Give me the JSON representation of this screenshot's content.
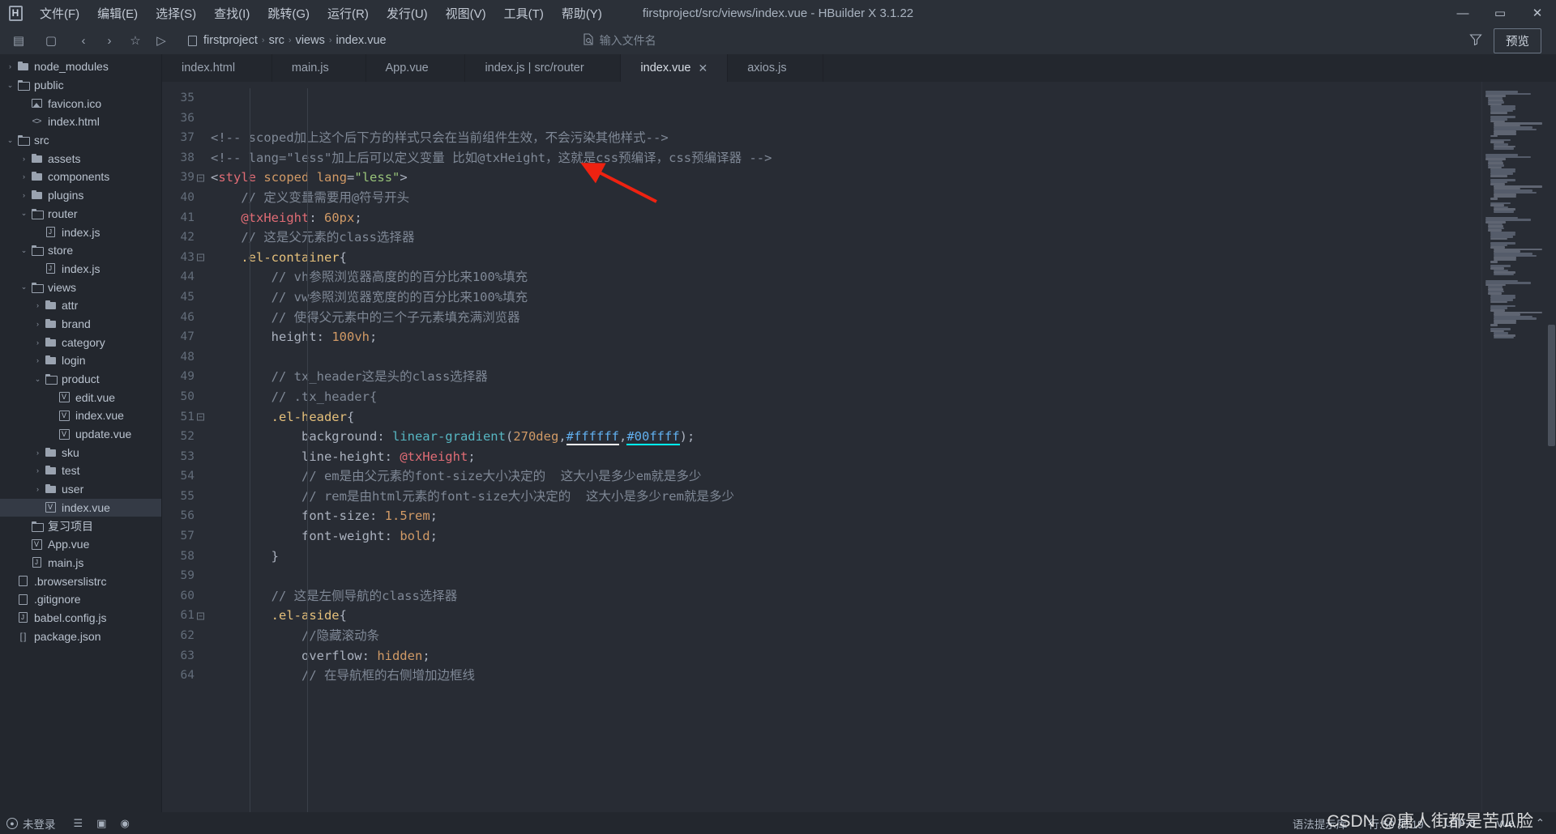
{
  "window": {
    "title": "firstproject/src/views/index.vue - HBuilder X 3.1.22",
    "logo": "H",
    "minimize": "—",
    "maximize": "▭",
    "close": "✕"
  },
  "menu": [
    {
      "label": "文件(F)",
      "name": "menu-file"
    },
    {
      "label": "编辑(E)",
      "name": "menu-edit"
    },
    {
      "label": "选择(S)",
      "name": "menu-select"
    },
    {
      "label": "查找(I)",
      "name": "menu-find"
    },
    {
      "label": "跳转(G)",
      "name": "menu-goto"
    },
    {
      "label": "运行(R)",
      "name": "menu-run"
    },
    {
      "label": "发行(U)",
      "name": "menu-publish"
    },
    {
      "label": "视图(V)",
      "name": "menu-view"
    },
    {
      "label": "工具(T)",
      "name": "menu-tools"
    },
    {
      "label": "帮助(Y)",
      "name": "menu-help"
    }
  ],
  "toolbar": {
    "buttons": [
      "▤",
      "▢",
      "‹",
      "›",
      "☆",
      "▷"
    ],
    "breadcrumb": [
      "firstproject",
      "src",
      "views",
      "index.vue"
    ],
    "breadcrumb_sep": "›",
    "file_search_placeholder": "输入文件名",
    "file_search_icon": "🔍",
    "filter_icon": "▽",
    "preview_label": "预览"
  },
  "sidebar": {
    "items": [
      {
        "label": "node_modules",
        "depth": 0,
        "arrow": "›",
        "icon": "folder",
        "selected": false
      },
      {
        "label": "public",
        "depth": 0,
        "arrow": "⌄",
        "icon": "folder-open",
        "selected": false
      },
      {
        "label": "favicon.ico",
        "depth": 1,
        "arrow": "",
        "icon": "image",
        "selected": false
      },
      {
        "label": "index.html",
        "depth": 1,
        "arrow": "",
        "icon": "code",
        "selected": false
      },
      {
        "label": "src",
        "depth": 0,
        "arrow": "⌄",
        "icon": "folder-open",
        "selected": false
      },
      {
        "label": "assets",
        "depth": 1,
        "arrow": "›",
        "icon": "folder",
        "selected": false
      },
      {
        "label": "components",
        "depth": 1,
        "arrow": "›",
        "icon": "folder",
        "selected": false
      },
      {
        "label": "plugins",
        "depth": 1,
        "arrow": "›",
        "icon": "folder",
        "selected": false
      },
      {
        "label": "router",
        "depth": 1,
        "arrow": "⌄",
        "icon": "folder-open",
        "selected": false
      },
      {
        "label": "index.js",
        "depth": 2,
        "arrow": "",
        "icon": "js",
        "selected": false
      },
      {
        "label": "store",
        "depth": 1,
        "arrow": "⌄",
        "icon": "folder-open",
        "selected": false
      },
      {
        "label": "index.js",
        "depth": 2,
        "arrow": "",
        "icon": "js",
        "selected": false
      },
      {
        "label": "views",
        "depth": 1,
        "arrow": "⌄",
        "icon": "folder-open",
        "selected": false
      },
      {
        "label": "attr",
        "depth": 2,
        "arrow": "›",
        "icon": "folder",
        "selected": false
      },
      {
        "label": "brand",
        "depth": 2,
        "arrow": "›",
        "icon": "folder",
        "selected": false
      },
      {
        "label": "category",
        "depth": 2,
        "arrow": "›",
        "icon": "folder",
        "selected": false
      },
      {
        "label": "login",
        "depth": 2,
        "arrow": "›",
        "icon": "folder",
        "selected": false
      },
      {
        "label": "product",
        "depth": 2,
        "arrow": "⌄",
        "icon": "folder-open",
        "selected": false
      },
      {
        "label": "edit.vue",
        "depth": 3,
        "arrow": "",
        "icon": "vue",
        "selected": false
      },
      {
        "label": "index.vue",
        "depth": 3,
        "arrow": "",
        "icon": "vue",
        "selected": false
      },
      {
        "label": "update.vue",
        "depth": 3,
        "arrow": "",
        "icon": "vue",
        "selected": false
      },
      {
        "label": "sku",
        "depth": 2,
        "arrow": "›",
        "icon": "folder",
        "selected": false
      },
      {
        "label": "test",
        "depth": 2,
        "arrow": "›",
        "icon": "folder",
        "selected": false
      },
      {
        "label": "user",
        "depth": 2,
        "arrow": "›",
        "icon": "folder",
        "selected": false
      },
      {
        "label": "index.vue",
        "depth": 2,
        "arrow": "",
        "icon": "vue",
        "selected": true
      },
      {
        "label": "复习项目",
        "depth": 1,
        "arrow": "",
        "icon": "folder-open",
        "selected": false
      },
      {
        "label": "App.vue",
        "depth": 1,
        "arrow": "",
        "icon": "vue",
        "selected": false
      },
      {
        "label": "main.js",
        "depth": 1,
        "arrow": "",
        "icon": "js",
        "selected": false
      },
      {
        "label": ".browserslistrc",
        "depth": 0,
        "arrow": "",
        "icon": "doc",
        "selected": false
      },
      {
        "label": ".gitignore",
        "depth": 0,
        "arrow": "",
        "icon": "doc",
        "selected": false
      },
      {
        "label": "babel.config.js",
        "depth": 0,
        "arrow": "",
        "icon": "js",
        "selected": false
      },
      {
        "label": "package.json",
        "depth": 0,
        "arrow": "",
        "icon": "json",
        "selected": false
      }
    ]
  },
  "tabs": [
    {
      "label": "index.html",
      "active": false,
      "close": "✕"
    },
    {
      "label": "main.js",
      "active": false,
      "close": "✕"
    },
    {
      "label": "App.vue",
      "active": false,
      "close": "✕"
    },
    {
      "label": "index.js | src/router",
      "active": false,
      "close": "✕"
    },
    {
      "label": "index.vue",
      "active": true,
      "close": "✕"
    },
    {
      "label": "axios.js",
      "active": false,
      "close": "✕"
    }
  ],
  "editor": {
    "first_line": 35,
    "lines": [
      {
        "n": 35,
        "fold": false,
        "tokens": []
      },
      {
        "n": 36,
        "fold": false,
        "tokens": []
      },
      {
        "n": 37,
        "fold": false,
        "tokens": [
          {
            "t": "<!-- scoped加上这个后下方的样式只会在当前组件生效，不会污染其他样式-->",
            "c": "c-cmt"
          }
        ]
      },
      {
        "n": 38,
        "fold": false,
        "tokens": [
          {
            "t": "<!-- lang=\"less\"加上后可以定义变量 比如@txHeight，这就是css预编译，css预编译器 -->",
            "c": "c-cmt"
          }
        ]
      },
      {
        "n": 39,
        "fold": true,
        "tokens": [
          {
            "t": "<",
            "c": "c-punc"
          },
          {
            "t": "style",
            "c": "c-tag"
          },
          {
            "t": " ",
            "c": "c-punc"
          },
          {
            "t": "scoped",
            "c": "c-attr"
          },
          {
            "t": " ",
            "c": "c-punc"
          },
          {
            "t": "lang",
            "c": "c-attr"
          },
          {
            "t": "=",
            "c": "c-punc"
          },
          {
            "t": "\"less\"",
            "c": "c-str"
          },
          {
            "t": ">",
            "c": "c-punc"
          }
        ]
      },
      {
        "n": 40,
        "fold": false,
        "tokens": [
          {
            "t": "    // 定义变量需要用@符号开头",
            "c": "c-cmt"
          }
        ]
      },
      {
        "n": 41,
        "fold": false,
        "tokens": [
          {
            "t": "    ",
            "c": "c-punc"
          },
          {
            "t": "@txHeight",
            "c": "c-var"
          },
          {
            "t": ": ",
            "c": "c-punc"
          },
          {
            "t": "60px",
            "c": "c-num"
          },
          {
            "t": ";",
            "c": "c-punc"
          }
        ]
      },
      {
        "n": 42,
        "fold": false,
        "tokens": [
          {
            "t": "    // 这是父元素的class选择器",
            "c": "c-cmt"
          }
        ]
      },
      {
        "n": 43,
        "fold": true,
        "tokens": [
          {
            "t": "    ",
            "c": "c-punc"
          },
          {
            "t": ".el-container",
            "c": "c-sel"
          },
          {
            "t": "{",
            "c": "c-punc"
          }
        ]
      },
      {
        "n": 44,
        "fold": false,
        "tokens": [
          {
            "t": "        // vh参照浏览器高度的的百分比来100%填充",
            "c": "c-cmt"
          }
        ]
      },
      {
        "n": 45,
        "fold": false,
        "tokens": [
          {
            "t": "        // vw参照浏览器宽度的的百分比来100%填充",
            "c": "c-cmt"
          }
        ]
      },
      {
        "n": 46,
        "fold": false,
        "tokens": [
          {
            "t": "        // 使得父元素中的三个子元素填充满浏览器",
            "c": "c-cmt"
          }
        ]
      },
      {
        "n": 47,
        "fold": false,
        "tokens": [
          {
            "t": "        ",
            "c": "c-punc"
          },
          {
            "t": "height",
            "c": "c-prop"
          },
          {
            "t": ": ",
            "c": "c-punc"
          },
          {
            "t": "100vh",
            "c": "c-num"
          },
          {
            "t": ";",
            "c": "c-punc"
          }
        ]
      },
      {
        "n": 48,
        "fold": false,
        "tokens": []
      },
      {
        "n": 49,
        "fold": false,
        "tokens": [
          {
            "t": "        // tx_header这是头的class选择器",
            "c": "c-cmt"
          }
        ]
      },
      {
        "n": 50,
        "fold": false,
        "tokens": [
          {
            "t": "        // .tx_header{",
            "c": "c-cmt"
          }
        ]
      },
      {
        "n": 51,
        "fold": true,
        "tokens": [
          {
            "t": "        ",
            "c": "c-punc"
          },
          {
            "t": ".el-header",
            "c": "c-sel"
          },
          {
            "t": "{",
            "c": "c-punc"
          }
        ]
      },
      {
        "n": 52,
        "fold": false,
        "tokens": [
          {
            "t": "            ",
            "c": "c-punc"
          },
          {
            "t": "background",
            "c": "c-prop"
          },
          {
            "t": ": ",
            "c": "c-punc"
          },
          {
            "t": "linear-gradient",
            "c": "c-fn"
          },
          {
            "t": "(",
            "c": "c-punc"
          },
          {
            "t": "270deg",
            "c": "c-num"
          },
          {
            "t": ",",
            "c": "c-punc"
          },
          {
            "t": "#ffffff",
            "c": "c-hexw"
          },
          {
            "t": ",",
            "c": "c-punc"
          },
          {
            "t": "#00ffff",
            "c": "c-hexc"
          },
          {
            "t": ");",
            "c": "c-punc"
          }
        ]
      },
      {
        "n": 53,
        "fold": false,
        "tokens": [
          {
            "t": "            ",
            "c": "c-punc"
          },
          {
            "t": "line-height",
            "c": "c-prop"
          },
          {
            "t": ": ",
            "c": "c-punc"
          },
          {
            "t": "@txHeight",
            "c": "c-var"
          },
          {
            "t": ";",
            "c": "c-punc"
          }
        ]
      },
      {
        "n": 54,
        "fold": false,
        "tokens": [
          {
            "t": "            // em是由父元素的font-size大小决定的  这大小是多少em就是多少",
            "c": "c-cmt"
          }
        ]
      },
      {
        "n": 55,
        "fold": false,
        "tokens": [
          {
            "t": "            // rem是由html元素的font-size大小决定的  这大小是多少rem就是多少",
            "c": "c-cmt"
          }
        ]
      },
      {
        "n": 56,
        "fold": false,
        "tokens": [
          {
            "t": "            ",
            "c": "c-punc"
          },
          {
            "t": "font-size",
            "c": "c-prop"
          },
          {
            "t": ": ",
            "c": "c-punc"
          },
          {
            "t": "1.5rem",
            "c": "c-num"
          },
          {
            "t": ";",
            "c": "c-punc"
          }
        ]
      },
      {
        "n": 57,
        "fold": false,
        "tokens": [
          {
            "t": "            ",
            "c": "c-punc"
          },
          {
            "t": "font-weight",
            "c": "c-prop"
          },
          {
            "t": ": ",
            "c": "c-punc"
          },
          {
            "t": "bold",
            "c": "c-num"
          },
          {
            "t": ";",
            "c": "c-punc"
          }
        ]
      },
      {
        "n": 58,
        "fold": false,
        "tokens": [
          {
            "t": "        }",
            "c": "c-punc"
          }
        ]
      },
      {
        "n": 59,
        "fold": false,
        "tokens": []
      },
      {
        "n": 60,
        "fold": false,
        "tokens": [
          {
            "t": "        // 这是左侧导航的class选择器",
            "c": "c-cmt"
          }
        ]
      },
      {
        "n": 61,
        "fold": true,
        "tokens": [
          {
            "t": "        ",
            "c": "c-punc"
          },
          {
            "t": ".el-aside",
            "c": "c-sel"
          },
          {
            "t": "{",
            "c": "c-punc"
          }
        ]
      },
      {
        "n": 62,
        "fold": false,
        "tokens": [
          {
            "t": "            //隐藏滚动条",
            "c": "c-cmt"
          }
        ]
      },
      {
        "n": 63,
        "fold": false,
        "tokens": [
          {
            "t": "            ",
            "c": "c-punc"
          },
          {
            "t": "overflow",
            "c": "c-prop"
          },
          {
            "t": ": ",
            "c": "c-punc"
          },
          {
            "t": "hidden",
            "c": "c-num"
          },
          {
            "t": ";",
            "c": "c-punc"
          }
        ]
      },
      {
        "n": 64,
        "fold": false,
        "tokens": [
          {
            "t": "            // 在导航框的右侧增加边框线",
            "c": "c-cmt"
          }
        ]
      }
    ]
  },
  "statusbar": {
    "user": "未登录",
    "user_icon": "①",
    "icons": [
      "☰",
      "▣",
      "◉"
    ],
    "syntax_lib": "语法提示库",
    "cursor": "行:50 列:19",
    "encoding": "UTF-8",
    "language": "vue",
    "caret": "⌃"
  },
  "watermark": "CSDN @唐人街都是苦瓜脸",
  "colors": {
    "accent_white": "#ffffff",
    "accent_cyan": "#00ffff",
    "bg_editor": "#282c34",
    "bg_panel": "#23272e",
    "bg_chrome": "#2b3038",
    "arrow_annotation": "#ee2211"
  }
}
